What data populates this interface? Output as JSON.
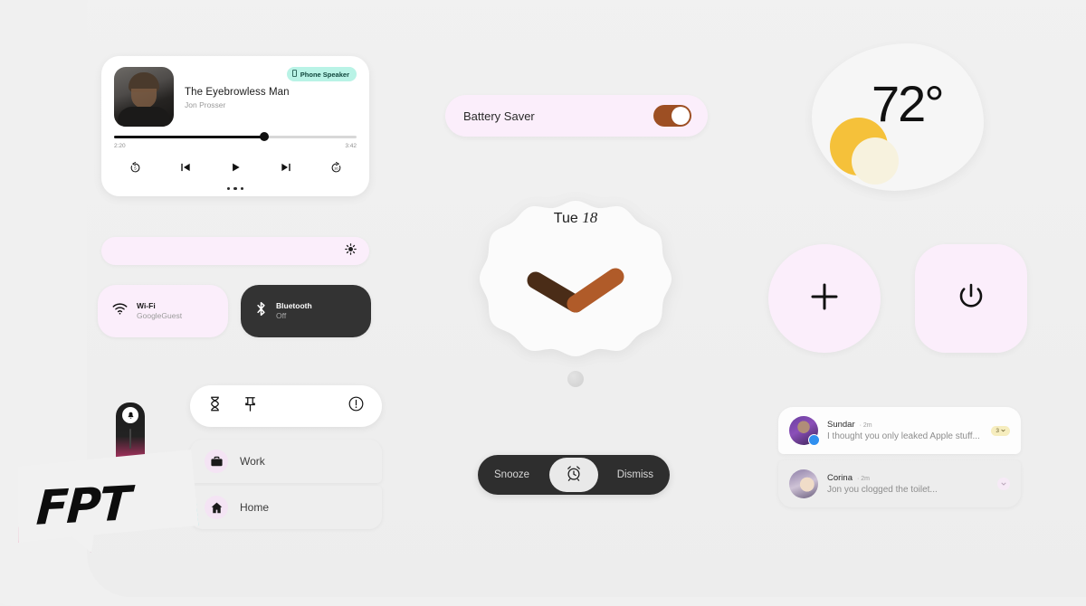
{
  "theme": {
    "background": "#efefef",
    "accent_pink": "#fbeefb",
    "accent_brown": "#9d4f23",
    "accent_mint": "#b9f3e6",
    "dark_tile": "#333333"
  },
  "media_player": {
    "title": "The Eyebrowless Man",
    "artist": "Jon Prosser",
    "output_badge": "Phone Speaker",
    "output_icon": "phone-icon",
    "elapsed": "2:20",
    "duration": "3:42",
    "progress_percent": 62,
    "controls": [
      {
        "name": "rewind-5-button",
        "glyph": "replay-5"
      },
      {
        "name": "previous-track-button",
        "glyph": "skip-previous"
      },
      {
        "name": "play-button",
        "glyph": "play"
      },
      {
        "name": "next-track-button",
        "glyph": "skip-next"
      },
      {
        "name": "forward-30-button",
        "glyph": "forward-30"
      }
    ],
    "page_dots": 3
  },
  "brightness_slider": {
    "icon": "brightness-icon",
    "value_percent": 100
  },
  "quick_tiles": [
    {
      "name": "Wi-Fi",
      "status": "GoogleGuest",
      "icon": "wifi-icon",
      "state": "on"
    },
    {
      "name": "Bluetooth",
      "status": "Off",
      "icon": "bluetooth-icon",
      "state": "off"
    }
  ],
  "shortcut_panel": {
    "toolbar_icons": [
      {
        "name": "hourglass-icon"
      },
      {
        "name": "pin-icon"
      },
      {
        "name": "info-icon"
      }
    ],
    "items": [
      {
        "label": "Work",
        "icon": "briefcase-icon"
      },
      {
        "label": "Home",
        "icon": "home-icon"
      }
    ]
  },
  "battery_saver": {
    "label": "Battery Saver",
    "enabled": true
  },
  "clock": {
    "weekday": "Tue",
    "day": "18",
    "hour_hand_color": "#4a2c17",
    "minute_hand_color": "#b05b29"
  },
  "alarm": {
    "snooze_label": "Snooze",
    "dismiss_label": "Dismiss",
    "center_icon": "alarm-clock-icon"
  },
  "weather": {
    "temperature": "72°",
    "icon": "sun-behind-cloud-icon"
  },
  "action_buttons": [
    {
      "name": "add-button",
      "icon": "plus-icon",
      "shape": "circle"
    },
    {
      "name": "power-button",
      "icon": "power-icon",
      "shape": "squircle"
    }
  ],
  "notifications": [
    {
      "sender": "Sundar",
      "time": "· 2m",
      "message": "I thought you only leaked Apple stuff...",
      "count": "3",
      "app_badge": "messenger-icon"
    },
    {
      "sender": "Corina",
      "time": "· 2m",
      "message": "Jon you clogged the toilet...",
      "count": "",
      "app_badge": ""
    }
  ],
  "watermark": {
    "text": "FPT",
    "icon": "bell-icon"
  }
}
